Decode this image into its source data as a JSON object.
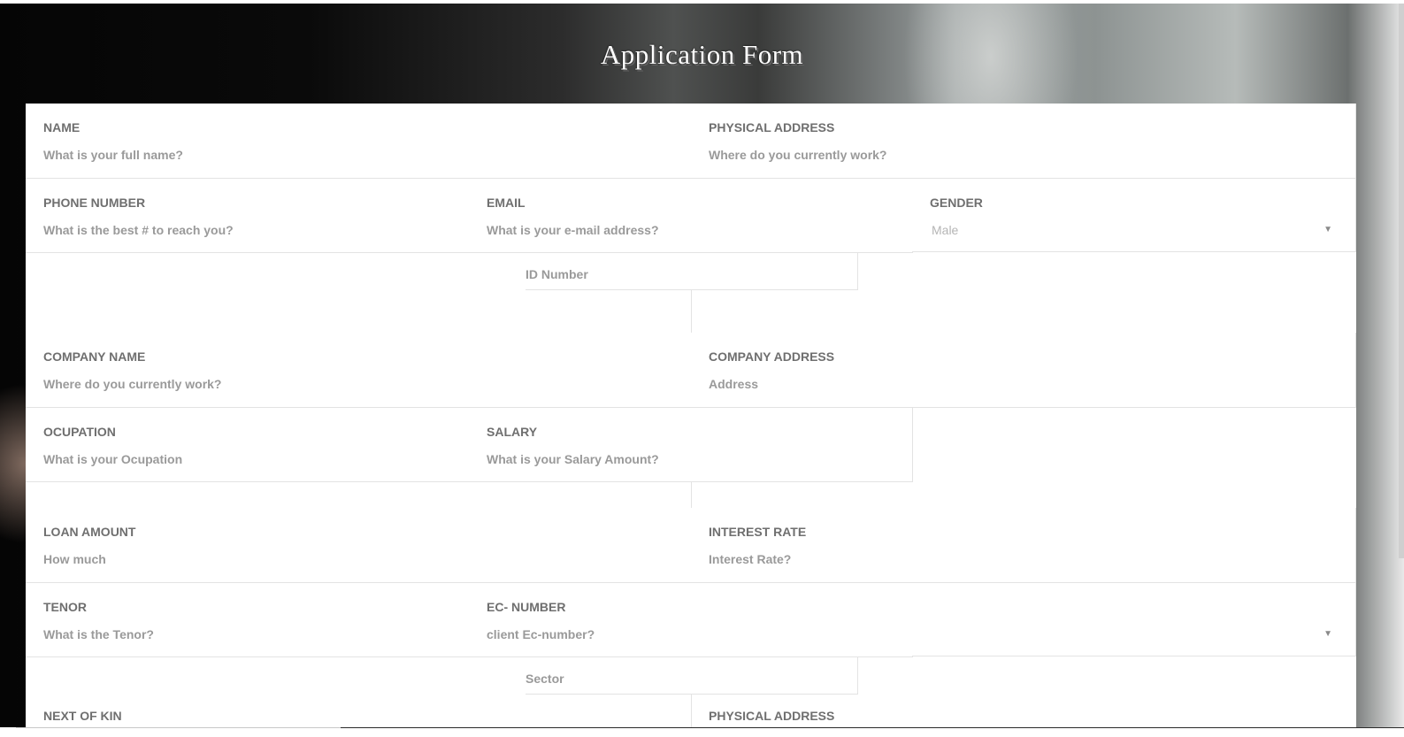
{
  "page": {
    "title": "Application Form"
  },
  "rows": {
    "row1": {
      "name": {
        "label": "NAME",
        "placeholder": "What is your full name?"
      },
      "physical_address": {
        "label": "PHYSICAL ADDRESS",
        "placeholder": "Where do you currently work?"
      }
    },
    "row2": {
      "phone": {
        "label": "PHONE NUMBER",
        "placeholder": "What is the best # to reach you?"
      },
      "email": {
        "label": "EMAIL",
        "placeholder": "What is your e-mail address?"
      },
      "gender": {
        "label": "GENDER",
        "value": "Male"
      }
    },
    "id_number": {
      "placeholder": "ID Number"
    },
    "row3": {
      "company_name": {
        "label": "COMPANY NAME",
        "placeholder": "Where do you currently work?"
      },
      "company_address": {
        "label": "COMPANY ADDRESS",
        "placeholder": "Address"
      }
    },
    "row4": {
      "occupation": {
        "label": "OCUPATION",
        "placeholder": "What is your  Ocupation"
      },
      "salary": {
        "label": "SALARY",
        "placeholder": "What is your Salary Amount?"
      }
    },
    "row5": {
      "loan_amount": {
        "label": "LOAN AMOUNT",
        "placeholder": "How much"
      },
      "interest_rate": {
        "label": "INTEREST RATE",
        "placeholder": "Interest Rate?"
      }
    },
    "row6": {
      "tenor": {
        "label": "TENOR",
        "placeholder": "What is the Tenor?"
      },
      "ec_number": {
        "label": "EC- NUMBER",
        "placeholder": "client Ec-number?"
      },
      "select": {
        "value": ""
      }
    },
    "sector": {
      "placeholder": "Sector"
    },
    "row7": {
      "next_of_kin": {
        "label": "NEXT OF KIN"
      },
      "physical_address": {
        "label": "PHYSICAL ADDRESS"
      }
    }
  },
  "icons": {
    "dropdown": "chevron-down-icon"
  }
}
